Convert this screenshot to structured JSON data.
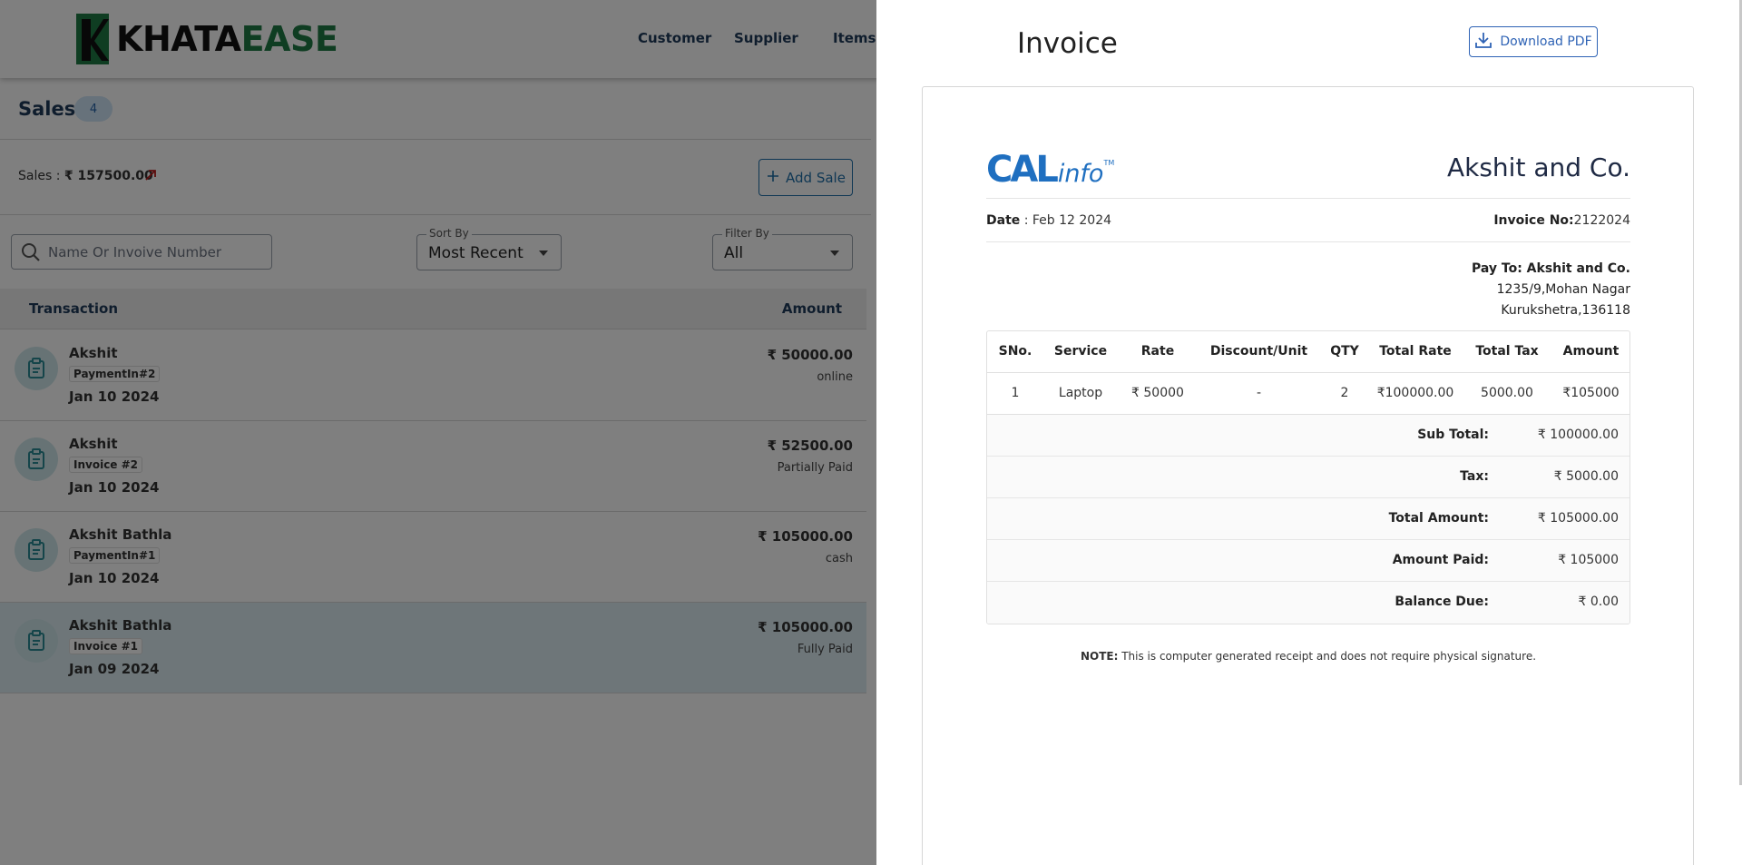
{
  "app": {
    "logo_k": "KHATA",
    "logo_e": "EASE",
    "nav": [
      "Customer",
      "Supplier",
      "Items"
    ],
    "page_title": "Sales",
    "sales_count": "4",
    "sales_total_label": "Sales :",
    "sales_total_value": "₹ 157500.00",
    "add_sale_label": "Add Sale",
    "search_placeholder": "Name Or Invoive Number",
    "sort": {
      "legend": "Sort By",
      "value": "Most Recent"
    },
    "filter": {
      "legend": "Filter By",
      "value": "All"
    },
    "table_headers": {
      "transaction": "Transaction",
      "amount": "Amount"
    },
    "transactions": [
      {
        "name": "Akshit",
        "tag": "PaymentIn#2",
        "date": "Jan 10 2024",
        "amount": "₹ 50000.00",
        "status": "online"
      },
      {
        "name": "Akshit",
        "tag": "Invoice #2",
        "date": "Jan 10 2024",
        "amount": "₹ 52500.00",
        "status": "Partially Paid"
      },
      {
        "name": "Akshit Bathla",
        "tag": "PaymentIn#1",
        "date": "Jan 10 2024",
        "amount": "₹ 105000.00",
        "status": "cash"
      },
      {
        "name": "Akshit Bathla",
        "tag": "Invoice #1",
        "date": "Jan 09 2024",
        "amount": "₹ 105000.00",
        "status": "Fully Paid"
      }
    ]
  },
  "invoice": {
    "title": "Invoice",
    "download_label": "Download PDF",
    "brand_cal": "CAL",
    "brand_info": "info",
    "brand_tm": "TM",
    "company": "Akshit and Co.",
    "date_label": "Date",
    "date_value": " : Feb 12 2024",
    "invoice_no_label": "Invoice No:",
    "invoice_no_value": "2122024",
    "pay_to": "Pay To: Akshit and Co.",
    "address_line1": "1235/9,Mohan Nagar",
    "address_line2": "Kurukshetra,136118",
    "columns": [
      "SNo.",
      "Service",
      "Rate",
      "Discount/Unit",
      "QTY",
      "Total Rate",
      "Total Tax",
      "Amount"
    ],
    "rows": [
      [
        "1",
        "Laptop",
        "₹ 50000",
        "-",
        "2",
        "₹100000.00",
        "5000.00",
        "₹105000"
      ]
    ],
    "summary": [
      {
        "label": "Sub Total:",
        "value": "₹ 100000.00"
      },
      {
        "label": "Tax:",
        "value": "₹ 5000.00"
      },
      {
        "label": "Total Amount:",
        "value": "₹ 105000.00"
      },
      {
        "label": "Amount Paid:",
        "value": "₹ 105000"
      },
      {
        "label": "Balance Due:",
        "value": "₹ 0.00"
      }
    ],
    "note_label": "NOTE:",
    "note_text": " This is computer generated receipt and does not require physical signature."
  },
  "colors": {
    "brand_blue": "#1f6fc0",
    "logo_green": "#1f7a45",
    "accent_blue": "#2f63b5",
    "overlay": "rgba(0,0,0,0.5)"
  },
  "icons": [
    "search-icon",
    "trending-up-icon",
    "plus-icon",
    "clipboard-icon",
    "download-icon",
    "caret-down-icon"
  ]
}
